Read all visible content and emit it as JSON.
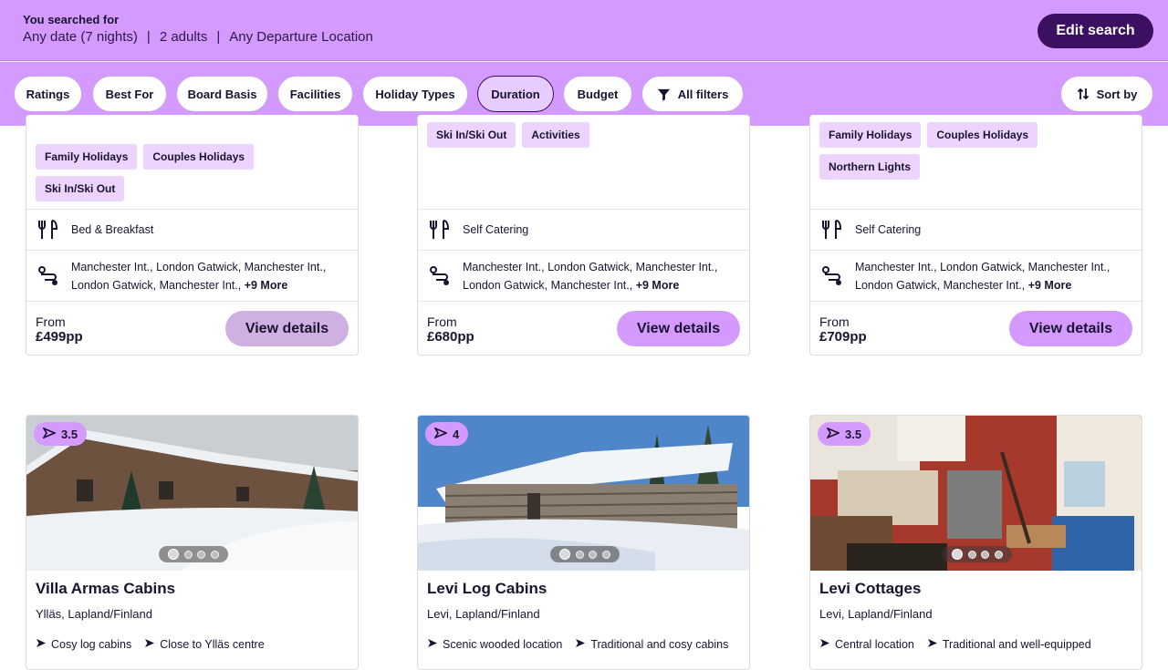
{
  "search": {
    "label": "You searched for",
    "date": "Any date (7 nights)",
    "guests": "2 adults",
    "departure": "Any Departure Location",
    "sep": "|",
    "edit_button": "Edit search"
  },
  "filters": {
    "chips": [
      "Ratings",
      "Best For",
      "Board Basis",
      "Facilities",
      "Holiday Types",
      "Duration",
      "Budget"
    ],
    "active": "Duration",
    "all_filters": "All filters",
    "sort_by": "Sort by"
  },
  "top_cards": [
    {
      "tags": [
        "Family Holidays",
        "Couples Holidays",
        "Ski In/Ski Out"
      ],
      "board": "Bed & Breakfast",
      "departures": "Manchester Int., London Gatwick, Manchester Int., London Gatwick, Manchester Int.,",
      "more": "+9 More",
      "from": "From",
      "price": "£499pp",
      "button": "View details"
    },
    {
      "tags": [
        "Ski In/Ski Out",
        "Activities"
      ],
      "board": "Self Catering",
      "departures": "Manchester Int., London Gatwick, Manchester Int., London Gatwick, Manchester Int.,",
      "more": "+9 More",
      "from": "From",
      "price": "£680pp",
      "button": "View details"
    },
    {
      "tags": [
        "Family Holidays",
        "Couples Holidays",
        "Northern Lights"
      ],
      "board": "Self Catering",
      "departures": "Manchester Int., London Gatwick, Manchester Int., London Gatwick, Manchester Int.,",
      "more": "+9 More",
      "from": "From",
      "price": "£709pp",
      "button": "View details"
    }
  ],
  "hotels": [
    {
      "rating": "3.5",
      "name": "Villa Armas Cabins",
      "location": "Ylläs, Lapland/Finland",
      "features": [
        "Cosy log cabins",
        "Close to Ylläs centre"
      ]
    },
    {
      "rating": "4",
      "name": "Levi Log Cabins",
      "location": "Levi, Lapland/Finland",
      "features": [
        "Scenic wooded location",
        "Traditional and cosy cabins"
      ]
    },
    {
      "rating": "3.5",
      "name": "Levi Cottages",
      "location": "Levi, Lapland/Finland",
      "features": [
        "Central location",
        "Traditional and well-equipped"
      ]
    }
  ],
  "colors": {
    "brand": "#d59aff",
    "dark": "#3b1061"
  },
  "icons": {
    "board": "cutlery-icon",
    "route": "route-icon",
    "filter": "filter-icon",
    "sort": "sort-icon",
    "rating": "tripadvisor-arrow-icon",
    "feature": "arrow-icon"
  }
}
